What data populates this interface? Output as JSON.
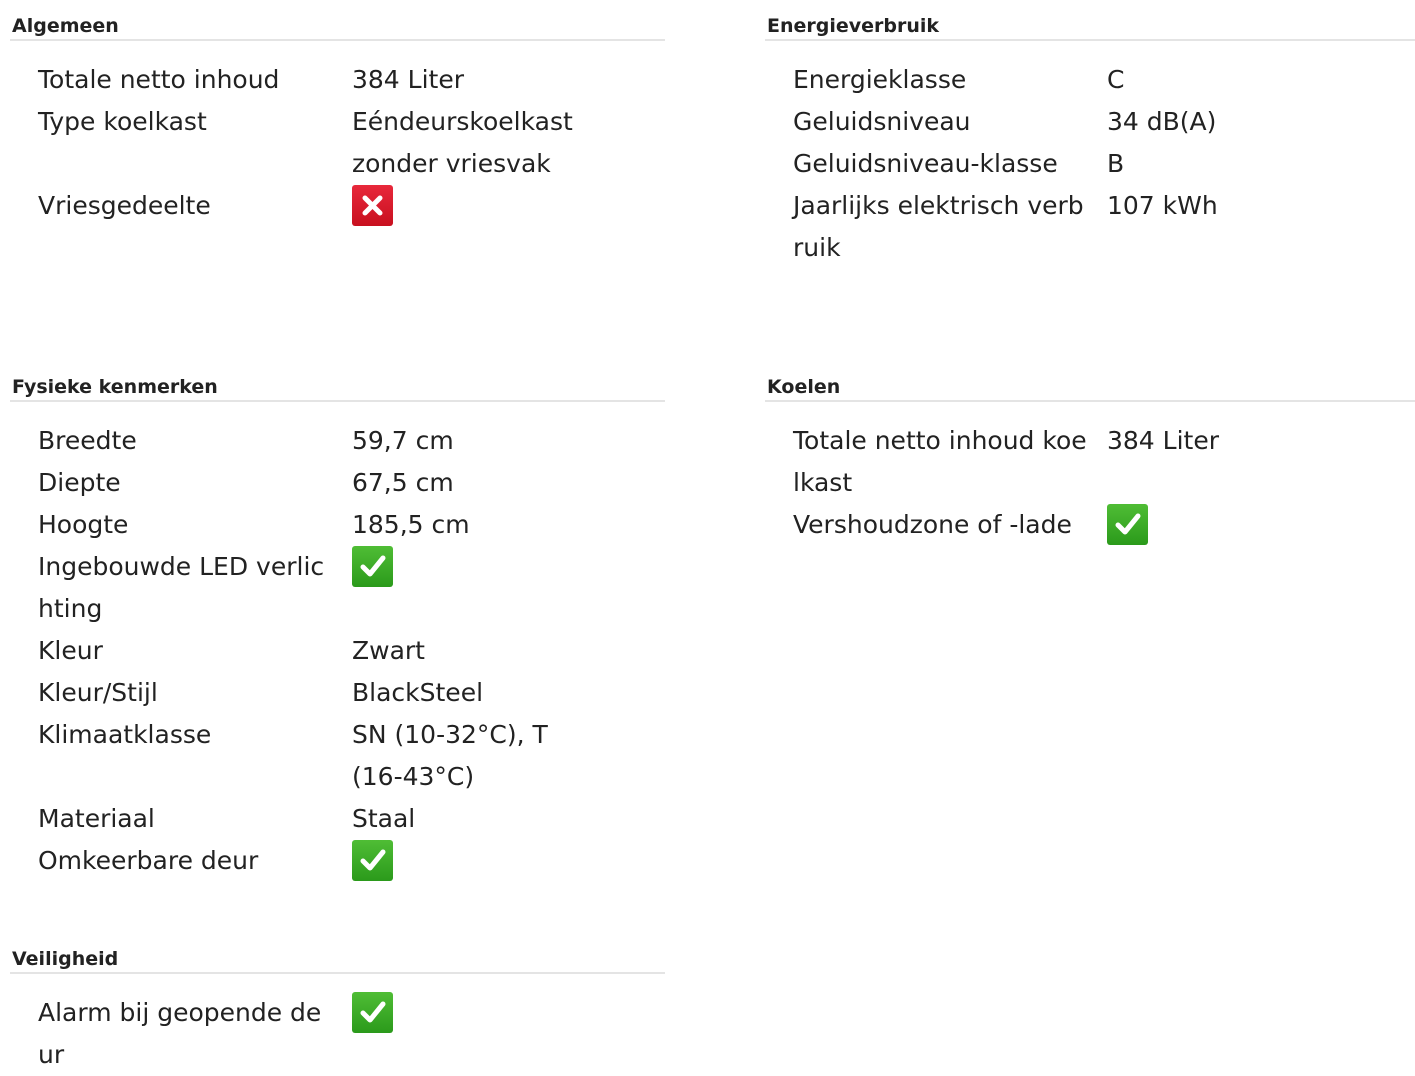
{
  "colors": {
    "check_green": "#3aaa28",
    "cross_red": "#d81a2c",
    "divider": "#e4e4e4"
  },
  "sections": {
    "algemeen": {
      "title": "Algemeen",
      "rows": [
        {
          "label": "Totale netto inhoud",
          "value": "384 Liter"
        },
        {
          "label": "Type koelkast",
          "value": "Eéndeurskoelkast zonder vriesvak"
        },
        {
          "label": "Vriesgedeelte",
          "icon": "cross-icon"
        }
      ]
    },
    "energieverbruik": {
      "title": "Energieverbruik",
      "rows": [
        {
          "label": "Energieklasse",
          "value": "C"
        },
        {
          "label": "Geluidsniveau",
          "value": "34 dB(A)"
        },
        {
          "label": "Geluidsniveau-klasse",
          "value": "B"
        },
        {
          "label": "Jaarlijks elektrisch verbruik",
          "value": "107 kWh"
        }
      ]
    },
    "fysieke": {
      "title": "Fysieke kenmerken",
      "rows": [
        {
          "label": "Breedte",
          "value": "59,7 cm"
        },
        {
          "label": "Diepte",
          "value": "67,5 cm"
        },
        {
          "label": "Hoogte",
          "value": "185,5 cm"
        },
        {
          "label": "Ingebouwde LED verlichting",
          "icon": "check-icon"
        },
        {
          "label": "Kleur",
          "value": "Zwart"
        },
        {
          "label": "Kleur/Stijl",
          "value": "BlackSteel"
        },
        {
          "label": "Klimaatklasse",
          "value": "SN (10-32°C), T (16-43°C)"
        },
        {
          "label": "Materiaal",
          "value": "Staal"
        },
        {
          "label": "Omkeerbare deur",
          "icon": "check-icon"
        }
      ]
    },
    "koelen": {
      "title": "Koelen",
      "rows": [
        {
          "label": "Totale netto inhoud koelkast",
          "value": "384 Liter"
        },
        {
          "label": "Vershoudzone of -lade",
          "icon": "check-icon"
        }
      ]
    },
    "veiligheid": {
      "title": "Veiligheid",
      "rows": [
        {
          "label": "Alarm bij geopende deur",
          "icon": "check-icon"
        }
      ]
    }
  }
}
